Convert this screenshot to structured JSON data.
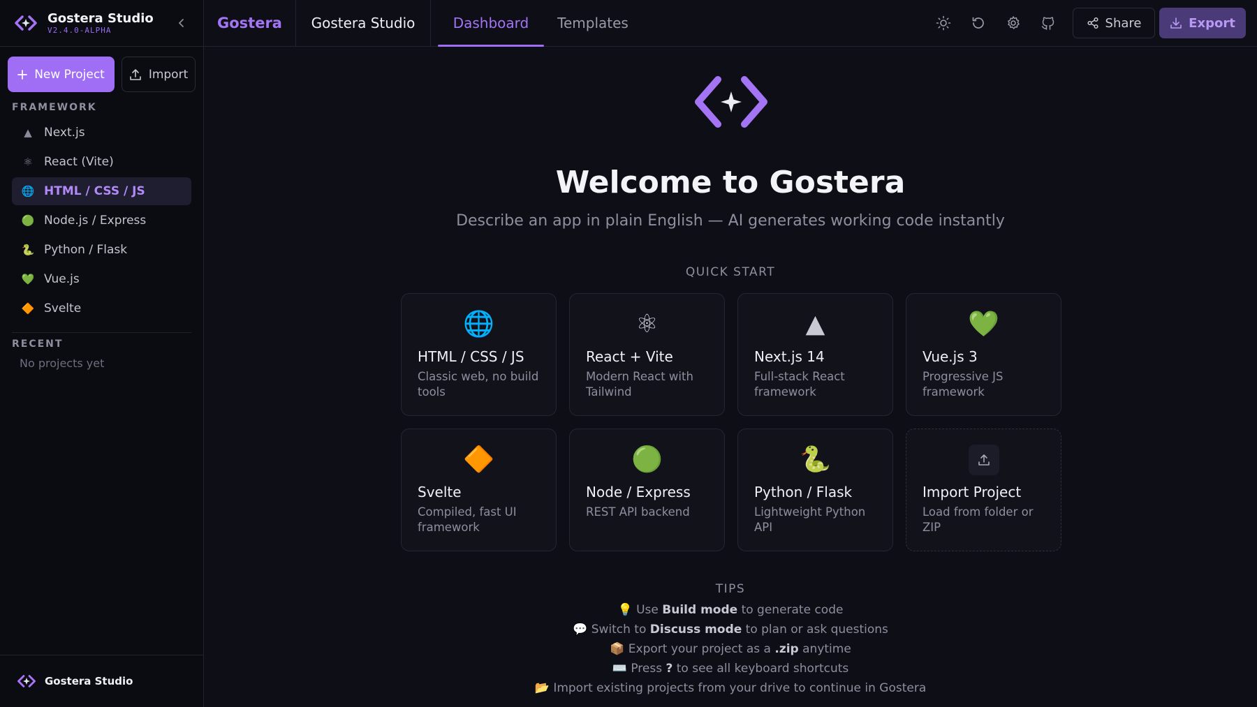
{
  "sidebar": {
    "title": "Gostera Studio",
    "version": "V2.4.0-ALPHA",
    "new_project_label": "New Project",
    "import_label": "Import",
    "framework_heading": "FRAMEWORK",
    "frameworks": [
      {
        "icon": "▲",
        "label": "Next.js"
      },
      {
        "icon": "⚛",
        "label": "React (Vite)"
      },
      {
        "icon": "🌐",
        "label": "HTML / CSS / JS"
      },
      {
        "icon": "🟢",
        "label": "Node.js / Express"
      },
      {
        "icon": "🐍",
        "label": "Python / Flask"
      },
      {
        "icon": "💚",
        "label": "Vue.js"
      },
      {
        "icon": "🔶",
        "label": "Svelte"
      }
    ],
    "active_framework": "HTML / CSS / JS",
    "recent_heading": "RECENT",
    "recent_empty": "No projects yet",
    "footer_label": "Gostera Studio"
  },
  "topbar": {
    "brand": "Gostera",
    "project_name": "Gostera Studio",
    "tabs": [
      {
        "label": "Dashboard",
        "active": true
      },
      {
        "label": "Templates",
        "active": false
      }
    ],
    "icons": [
      "sun-icon",
      "history-icon",
      "settings-icon",
      "github-icon"
    ],
    "share_label": "Share",
    "export_label": "Export"
  },
  "main": {
    "welcome": "Welcome to Gostera",
    "subtitle": "Describe an app in plain English — AI generates working code instantly",
    "quick_start_label": "QUICK START",
    "cards": [
      {
        "icon": "🌐",
        "title": "HTML / CSS / JS",
        "desc": "Classic web, no build tools"
      },
      {
        "icon": "⚛",
        "title": "React + Vite",
        "desc": "Modern React with Tailwind"
      },
      {
        "icon": "▲",
        "title": "Next.js 14",
        "desc": "Full-stack React framework"
      },
      {
        "icon": "💚",
        "title": "Vue.js 3",
        "desc": "Progressive JS framework"
      },
      {
        "icon": "🔶",
        "title": "Svelte",
        "desc": "Compiled, fast UI framework"
      },
      {
        "icon": "🟢",
        "title": "Node / Express",
        "desc": "REST API backend"
      },
      {
        "icon": "🐍",
        "title": "Python / Flask",
        "desc": "Lightweight Python API"
      },
      {
        "icon": "upload-icon",
        "title": "Import Project",
        "desc": "Load from folder or ZIP"
      }
    ],
    "tips_label": "TIPS",
    "tips": [
      {
        "emoji": "💡",
        "pre": "Use ",
        "bold": "Build mode",
        "post": " to generate code"
      },
      {
        "emoji": "💬",
        "pre": "Switch to ",
        "bold": "Discuss mode",
        "post": " to plan or ask questions"
      },
      {
        "emoji": "📦",
        "pre": "Export your project as a ",
        "bold": ".zip",
        "post": " anytime"
      },
      {
        "emoji": "⌨️",
        "pre": "Press ",
        "bold": "?",
        "post": " to see all keyboard shortcuts"
      },
      {
        "emoji": "📂",
        "pre": "Import existing projects from your drive to continue in Gostera",
        "bold": "",
        "post": ""
      }
    ]
  },
  "colors": {
    "accent": "#9f6ef5",
    "background": "#0e0e16",
    "sidebar_bg": "#0b0b12"
  }
}
